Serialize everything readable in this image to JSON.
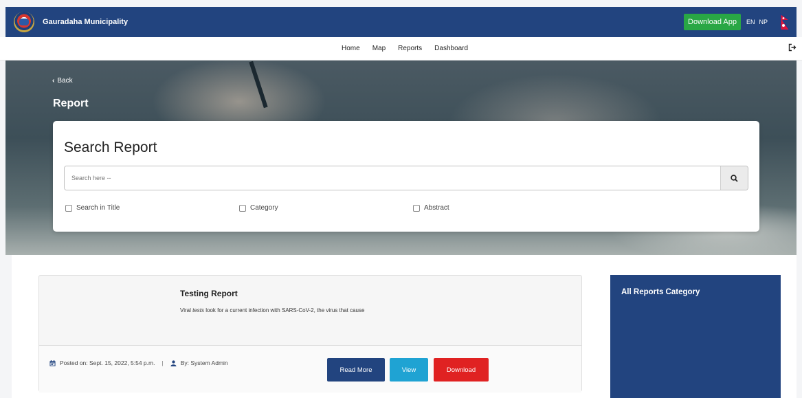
{
  "header": {
    "title": "Gauradaha Municipality",
    "download_app": "Download App",
    "lang_en": "EN",
    "lang_np": "NP",
    "logo_icon": "municipality-emblem-icon",
    "flag_icon": "nepal-flag-icon"
  },
  "nav": {
    "items": [
      "Home",
      "Map",
      "Reports",
      "Dashboard"
    ],
    "logout_icon": "sign-out-icon"
  },
  "hero": {
    "back": "Back",
    "title": "Report"
  },
  "search": {
    "title": "Search Report",
    "placeholder": "Search here --",
    "button_icon": "search-icon",
    "options": [
      "Search in Title",
      "Category",
      "Abstract"
    ]
  },
  "report": {
    "title": "Testing Report",
    "desc_before": "Viral ",
    "desc_emph": "tests",
    "desc_after": " look for a current infection with SARS-CoV-2, the virus that cause",
    "posted": "Posted on: Sept. 15, 2022, 5:54 p.m.",
    "separator": "|",
    "by": "By: System Admin",
    "read_more": "Read More",
    "view": "View",
    "download": "Download"
  },
  "sidebar": {
    "title": "All Reports Category"
  },
  "colors": {
    "primary": "#22447f",
    "success": "#29a745",
    "info": "#1fa3d3",
    "danger": "#e02222"
  }
}
